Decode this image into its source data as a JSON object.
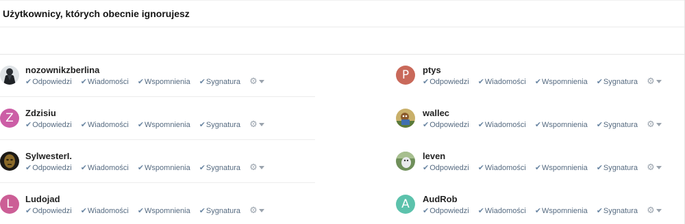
{
  "header": {
    "title": "Użytkownicy, których obecnie ignorujesz"
  },
  "action_labels": {
    "replies": "Odpowiedzi",
    "messages": "Wiadomości",
    "mentions": "Wspomnienia",
    "signature": "Sygnatura"
  },
  "users": [
    {
      "name": "nozownikzberlina",
      "avatar": {
        "type": "photo",
        "icon": "dark-figure-avatar-icon"
      }
    },
    {
      "name": "ptys",
      "avatar": {
        "type": "letter",
        "letter": "P",
        "color": "#c9695a"
      }
    },
    {
      "name": "Zdzisiu",
      "avatar": {
        "type": "letter",
        "letter": "Z",
        "color": "#cc5ea6"
      }
    },
    {
      "name": "wallec",
      "avatar": {
        "type": "photo",
        "icon": "cartoon-avatar-icon"
      }
    },
    {
      "name": "SylwesterI.",
      "avatar": {
        "type": "photo",
        "icon": "bronze-mask-avatar-icon"
      }
    },
    {
      "name": "leven",
      "avatar": {
        "type": "photo",
        "icon": "animal-photo-avatar-icon"
      }
    },
    {
      "name": "Ludojad",
      "avatar": {
        "type": "letter",
        "letter": "L",
        "color": "#cc5e96"
      }
    },
    {
      "name": "AudRob",
      "avatar": {
        "type": "letter",
        "letter": "A",
        "color": "#5cc2ac"
      }
    }
  ],
  "icons": {
    "check": "checkmark-icon",
    "settings": "gear-icon",
    "dropdown": "caret-down-icon"
  }
}
